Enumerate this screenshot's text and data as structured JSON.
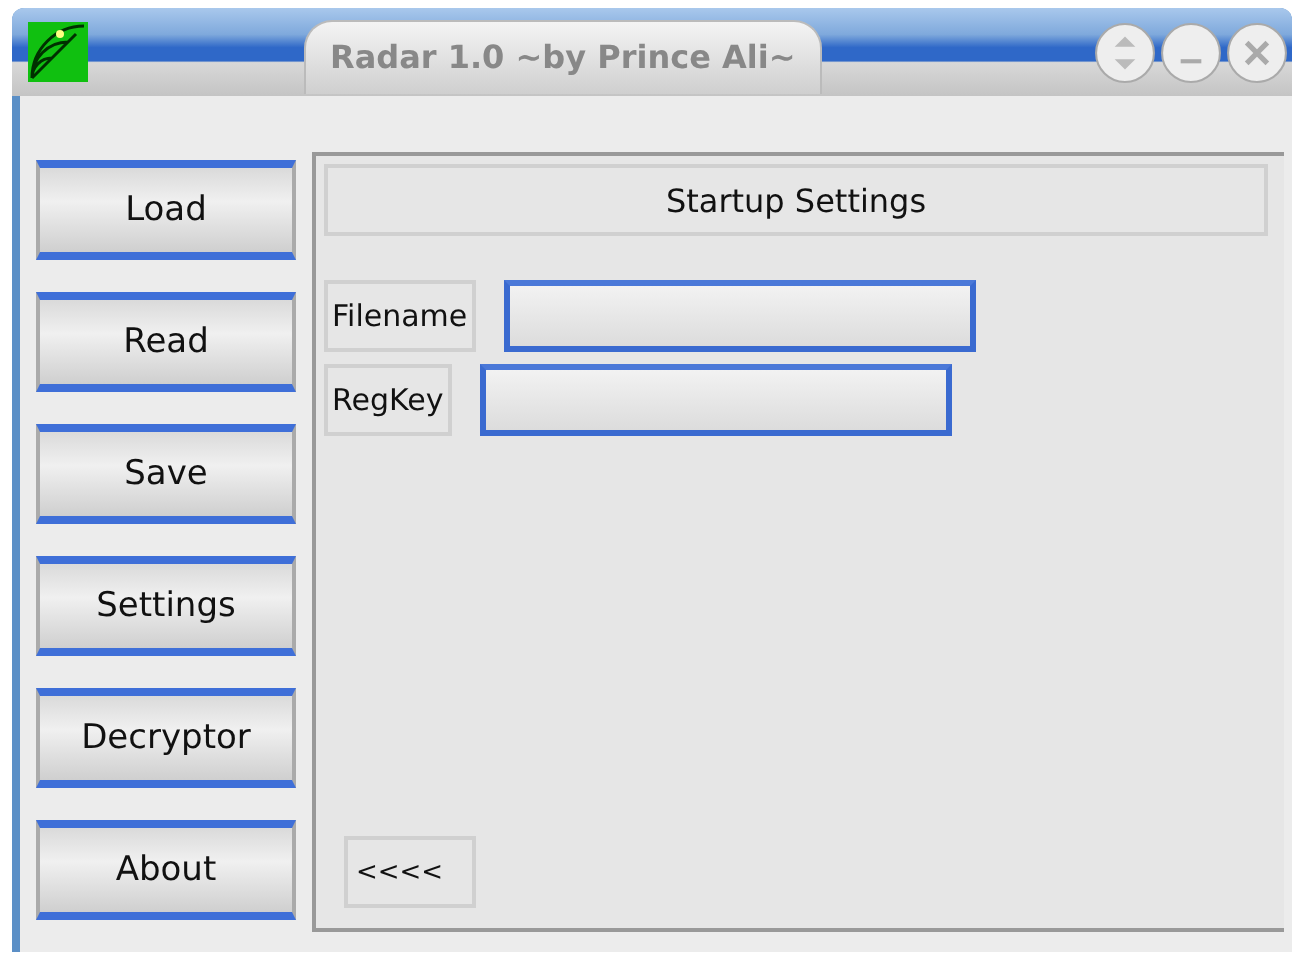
{
  "window": {
    "title": "Radar 1.0 ~by Prince Ali~"
  },
  "sidebar": {
    "buttons": [
      {
        "label": "Load"
      },
      {
        "label": "Read"
      },
      {
        "label": "Save"
      },
      {
        "label": "Settings"
      },
      {
        "label": "Decryptor"
      },
      {
        "label": "About"
      }
    ]
  },
  "panel": {
    "heading": "Startup Settings",
    "fields": [
      {
        "label": "Filename"
      },
      {
        "label": "RegKey"
      }
    ],
    "back_button": "<<<<"
  }
}
